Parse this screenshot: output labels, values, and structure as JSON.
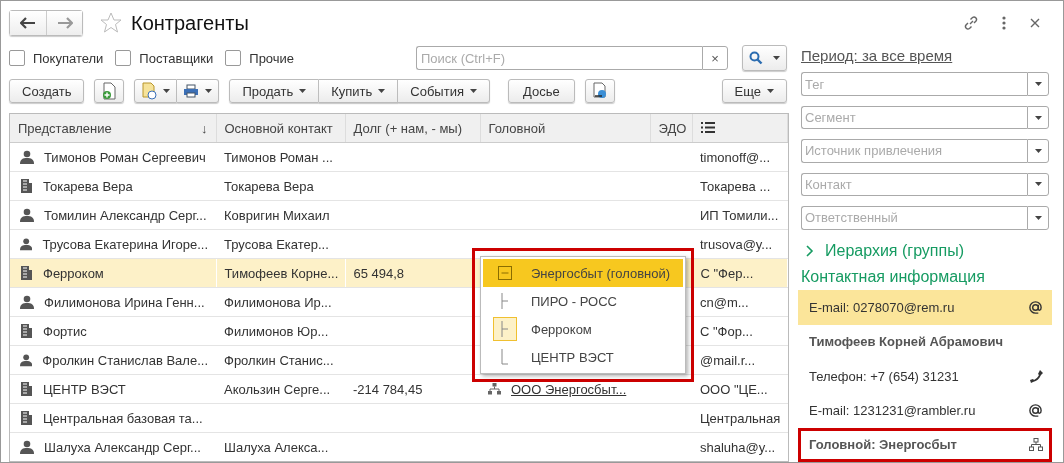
{
  "window": {
    "title": "Контрагенты"
  },
  "filters": [
    {
      "label": "Покупатели",
      "checked": false
    },
    {
      "label": "Поставщики",
      "checked": false
    },
    {
      "label": "Прочие",
      "checked": false
    }
  ],
  "search": {
    "placeholder": "Поиск (Ctrl+F)",
    "clear": "×"
  },
  "toolbar": {
    "create": "Создать",
    "groups": [
      [
        "Продать",
        "Купить",
        "События"
      ]
    ],
    "dossier": "Досье",
    "more": "Еще"
  },
  "table": {
    "columns": [
      {
        "label": "Представление",
        "sort": "↓"
      },
      {
        "label": "Основной контакт"
      },
      {
        "label": "Долг (+ нам, - мы)"
      },
      {
        "label": "Головной"
      },
      {
        "label": "ЭДО"
      },
      {
        "kind": "list"
      }
    ],
    "rows": [
      {
        "kind": "person",
        "selected": false,
        "cells": [
          "Тимонов Роман Сергеевич",
          "Тимонов Роман ...",
          "",
          "",
          "",
          "timonoff@..."
        ]
      },
      {
        "kind": "company",
        "selected": false,
        "cells": [
          "Токарева Вера",
          "Токарева Вера",
          "",
          "",
          "",
          "Токарева ..."
        ]
      },
      {
        "kind": "person",
        "selected": false,
        "cells": [
          "Томилин Александр Серг...",
          "Ковригин Михаил",
          "",
          "",
          "",
          "ИП Томили..."
        ]
      },
      {
        "kind": "person",
        "selected": false,
        "cells": [
          "Трусова Екатерина Игоре...",
          "Трусова Екатер...",
          "",
          "",
          "",
          "trusova@y..."
        ]
      },
      {
        "kind": "company",
        "selected": true,
        "cells": [
          "Ферроком",
          "Тимофеев Корне...",
          "65 494,8",
          "",
          "",
          "С \"Фер..."
        ]
      },
      {
        "kind": "person",
        "selected": false,
        "cells": [
          "Филимонова Ирина Генн...",
          "Филимонова Ир...",
          "",
          "",
          "",
          "cn@m..."
        ]
      },
      {
        "kind": "company",
        "selected": false,
        "cells": [
          "Фортис",
          "Филимонов Юр...",
          "",
          "",
          "",
          "С \"Фор..."
        ]
      },
      {
        "kind": "person",
        "selected": false,
        "cells": [
          "Фролкин Станислав Вале...",
          "Фролкин Станис...",
          "",
          "",
          "",
          "@mail.r..."
        ]
      },
      {
        "kind": "company",
        "selected": false,
        "cells": [
          "ЦЕНТР ВЭСТ",
          "Акользин Серге...",
          "-214 784,45",
          "ООО Энергосбыт...",
          "",
          "ООО \"ЦЕ..."
        ]
      },
      {
        "kind": "company",
        "selected": false,
        "cells": [
          "Центральная базовая та...",
          "",
          "",
          "",
          "",
          "Центральная"
        ]
      },
      {
        "kind": "person",
        "selected": false,
        "cells": [
          "Шалуха Александр Серг...",
          "Шалуха Алекса...",
          "",
          "",
          "",
          "shaluha@y..."
        ]
      }
    ]
  },
  "popup": {
    "highlighted": true,
    "items": [
      {
        "label": "Энергосбыт (головной)",
        "kind": "root",
        "selected": true
      },
      {
        "label": "ПИРО - РОСС",
        "kind": "branch",
        "selected": false
      },
      {
        "label": "Ферроком",
        "kind": "branch",
        "selected": false,
        "current": true
      },
      {
        "label": "ЦЕНТР ВЭСТ",
        "kind": "last",
        "selected": false
      }
    ]
  },
  "side": {
    "period": "Период: за все время",
    "selects": [
      {
        "placeholder": "Тег"
      },
      {
        "placeholder": "Сегмент"
      },
      {
        "placeholder": "Источник привлечения"
      },
      {
        "placeholder": "Контакт"
      },
      {
        "placeholder": "Ответственный"
      }
    ],
    "hierarchy": {
      "label": "Иерархия (группы)",
      "expanded": false
    },
    "contact_title": "Контактная информация",
    "contacts": [
      {
        "text": "E-mail: 0278070@rem.ru",
        "kind": "email",
        "selected": true,
        "highlighted": false
      },
      {
        "text": "Тимофеев Корней Абрамович",
        "kind": "name",
        "selected": false,
        "highlighted": false
      },
      {
        "text": "Телефон: +7 (654) 31231",
        "kind": "phone",
        "selected": false,
        "highlighted": false
      },
      {
        "text": "E-mail: 1231231@rambler.ru",
        "kind": "email",
        "selected": false,
        "highlighted": false
      },
      {
        "text": "Головной: Энергосбыт",
        "kind": "head",
        "selected": false,
        "highlighted": true
      }
    ]
  }
}
